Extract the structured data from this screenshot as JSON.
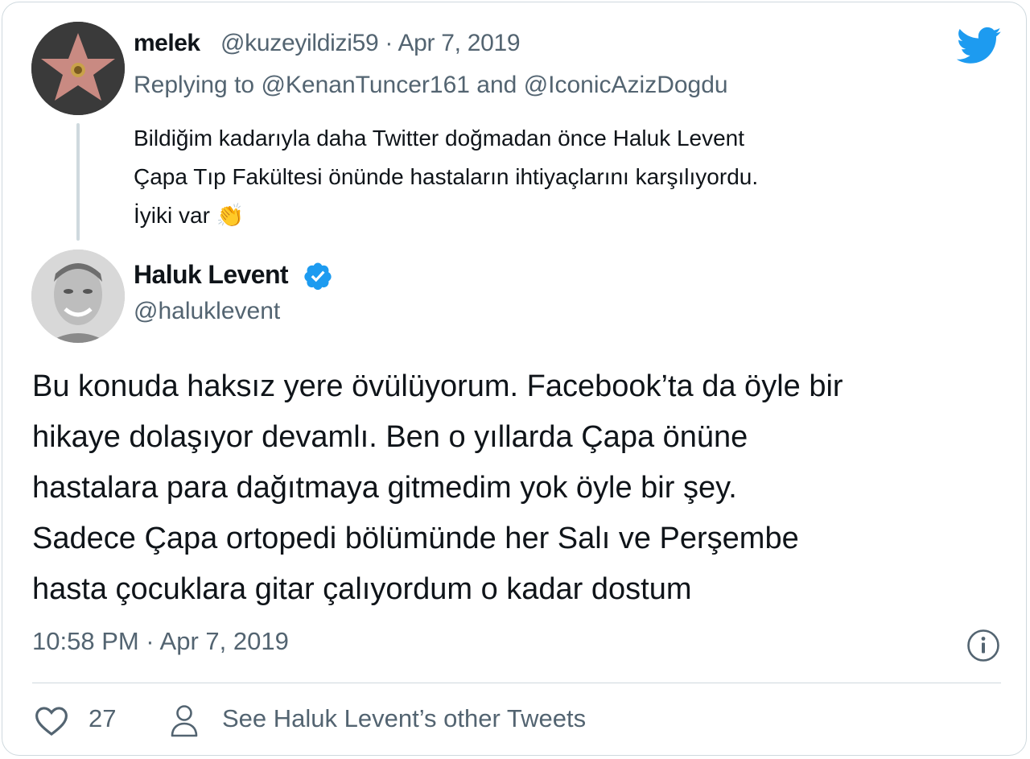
{
  "parent_tweet": {
    "display_name": "melek",
    "handle_date": "@kuzeyildizi59 · Apr 7, 2019",
    "replying_prefix": "Replying to",
    "mention1": "@KenanTuncer161",
    "and_text": "and",
    "mention2": "@IconicAzizDogdu",
    "text_lines": [
      "Bildiğim kadarıyla daha Twitter doğmadan önce Haluk Levent",
      "Çapa Tıp Fakültesi önünde hastaların ihtiyaçlarını karşılıyordu.",
      "İyiki var 👏"
    ]
  },
  "main_tweet": {
    "display_name": "Haluk Levent",
    "handle": "@haluklevent",
    "text_lines": [
      "Bu konuda haksız yere övülüyorum. Facebook’ta da öyle bir",
      "hikaye dolaşıyor devamlı. Ben o yıllarda Çapa önüne",
      "hastalara para dağıtmaya gitmedim yok öyle bir şey.",
      "Sadece Çapa ortopedi bölümünde her Salı ve Perşembe",
      "hasta çocuklara gitar çalıyordum o kadar dostum"
    ],
    "timestamp": "10:58 PM · Apr 7, 2019",
    "like_count": "27",
    "other_tweets_label": "See Haluk Levent’s other Tweets"
  },
  "icons": {
    "brand": "twitter-bird-icon",
    "verified": "verified-badge-icon",
    "info": "info-icon",
    "like": "heart-icon",
    "profile": "person-icon"
  },
  "colors": {
    "brand_blue": "#1d9bf0",
    "secondary_text": "#536471",
    "border": "#cfd9de"
  }
}
